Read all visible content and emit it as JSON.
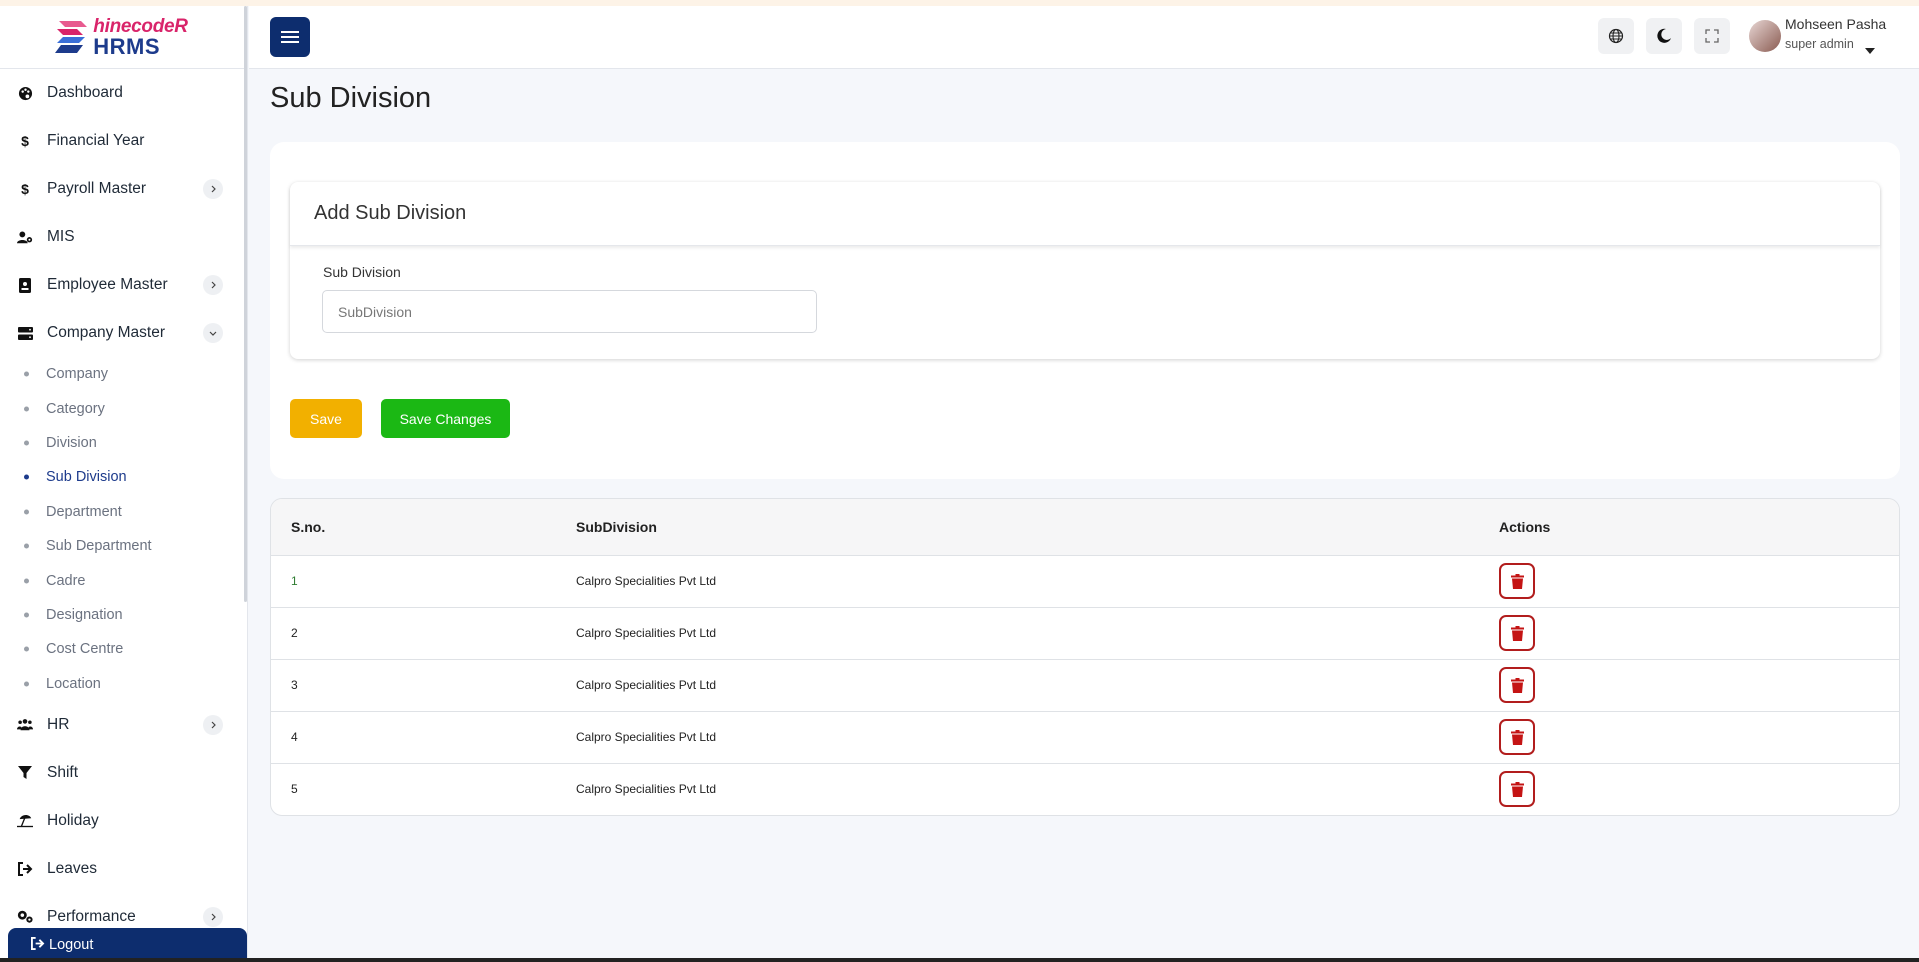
{
  "brand": {
    "logo_top": "hinecodeR",
    "logo_bottom": "HRMS"
  },
  "sidebar": {
    "items": [
      {
        "label": "Dashboard",
        "icon": "palette-icon"
      },
      {
        "label": "Financial Year",
        "icon": "dollar-icon"
      },
      {
        "label": "Payroll Master",
        "icon": "dollar-icon",
        "chevron": "right"
      },
      {
        "label": "MIS",
        "icon": "user-gear-icon"
      },
      {
        "label": "Employee Master",
        "icon": "id-badge-icon",
        "chevron": "right"
      },
      {
        "label": "Company Master",
        "icon": "server-icon",
        "chevron": "down"
      }
    ],
    "company_sub": [
      {
        "label": "Company"
      },
      {
        "label": "Category"
      },
      {
        "label": "Division"
      },
      {
        "label": "Sub Division",
        "active": true
      },
      {
        "label": "Department"
      },
      {
        "label": "Sub Department"
      },
      {
        "label": "Cadre"
      },
      {
        "label": "Designation"
      },
      {
        "label": "Cost Centre"
      },
      {
        "label": "Location"
      }
    ],
    "items_after": [
      {
        "label": "HR",
        "icon": "users-icon",
        "chevron": "right"
      },
      {
        "label": "Shift",
        "icon": "filter-icon"
      },
      {
        "label": "Holiday",
        "icon": "umbrella-beach-icon"
      },
      {
        "label": "Leaves",
        "icon": "sign-out-icon"
      },
      {
        "label": "Performance",
        "icon": "gears-icon",
        "chevron": "right"
      }
    ],
    "logout_label": "Logout"
  },
  "header": {
    "user_name": "Mohseen Pasha",
    "user_role": "super admin",
    "icons": [
      "globe-icon",
      "moon-icon",
      "fullscreen-icon"
    ]
  },
  "main": {
    "page_title": "Sub Division",
    "form": {
      "card_title": "Add Sub Division",
      "field_label": "Sub Division",
      "field_placeholder": "SubDivision",
      "field_value": "",
      "save_label": "Save",
      "save_changes_label": "Save Changes"
    },
    "table": {
      "columns": [
        "S.no.",
        "SubDivision",
        "Actions"
      ],
      "rows": [
        {
          "sno": "1",
          "name": "Calpro Specialities Pvt Ltd"
        },
        {
          "sno": "2",
          "name": "Calpro Specialities Pvt Ltd"
        },
        {
          "sno": "3",
          "name": "Calpro Specialities Pvt Ltd"
        },
        {
          "sno": "4",
          "name": "Calpro Specialities Pvt Ltd"
        },
        {
          "sno": "5",
          "name": "Calpro Specialities Pvt Ltd"
        }
      ]
    }
  },
  "colors": {
    "primary": "#0d2d6e",
    "save": "#f2b000",
    "save_changes": "#1bb814",
    "delete": "#b21d1d",
    "brand_pink": "#d9246a"
  }
}
